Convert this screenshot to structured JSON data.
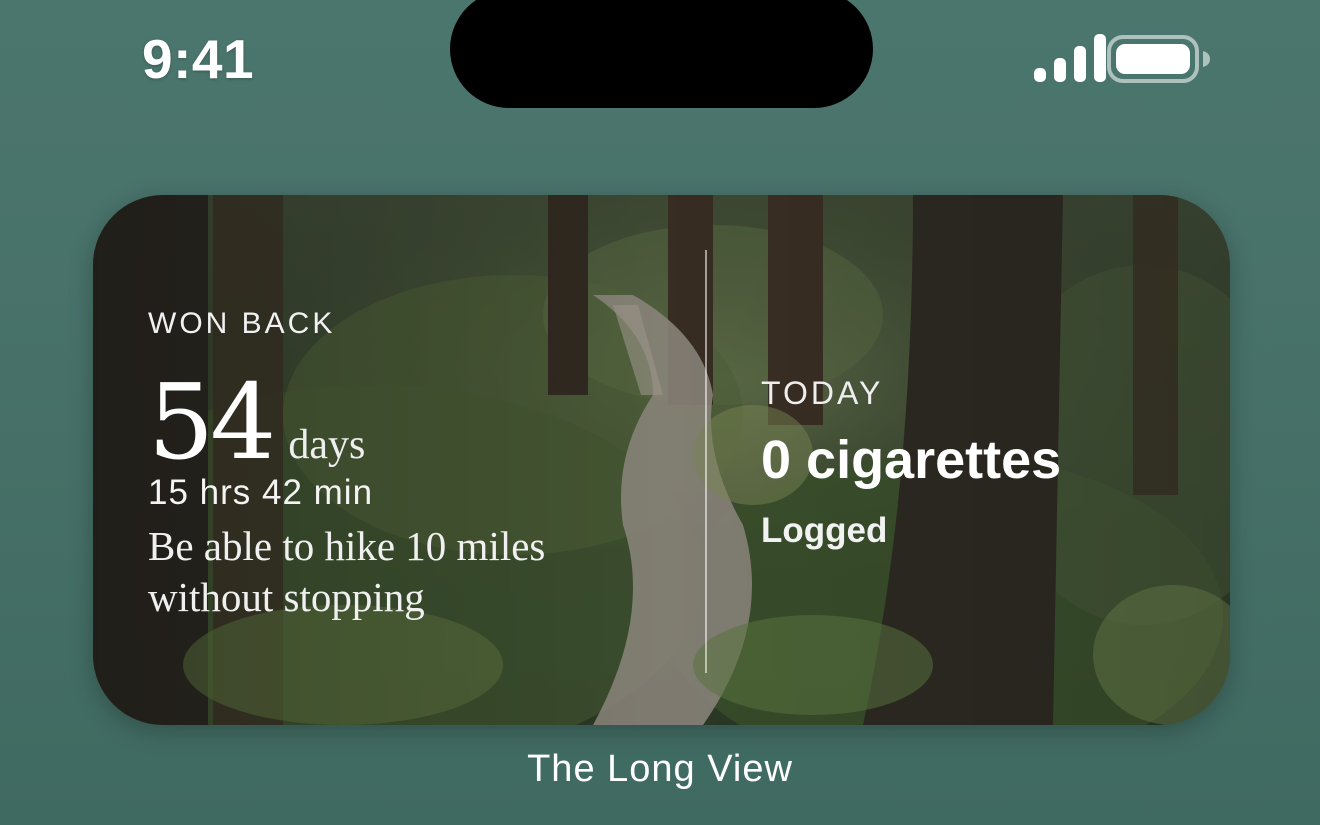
{
  "status_bar": {
    "time": "9:41",
    "signal_icon": "cellular-signal-icon",
    "battery_icon": "battery-full-icon"
  },
  "widget": {
    "background": "forest-trail-photo",
    "left": {
      "label": "WON BACK",
      "days_number": "54",
      "days_unit": "days",
      "time_remaining": "15 hrs 42 min",
      "goal": "Be able to hike 10 miles without stopping"
    },
    "right": {
      "label": "TODAY",
      "count": "0 cigarettes",
      "status": "Logged"
    }
  },
  "caption": "The Long View",
  "colors": {
    "background": "#4b766e",
    "island": "#000000",
    "text": "#ffffff"
  }
}
